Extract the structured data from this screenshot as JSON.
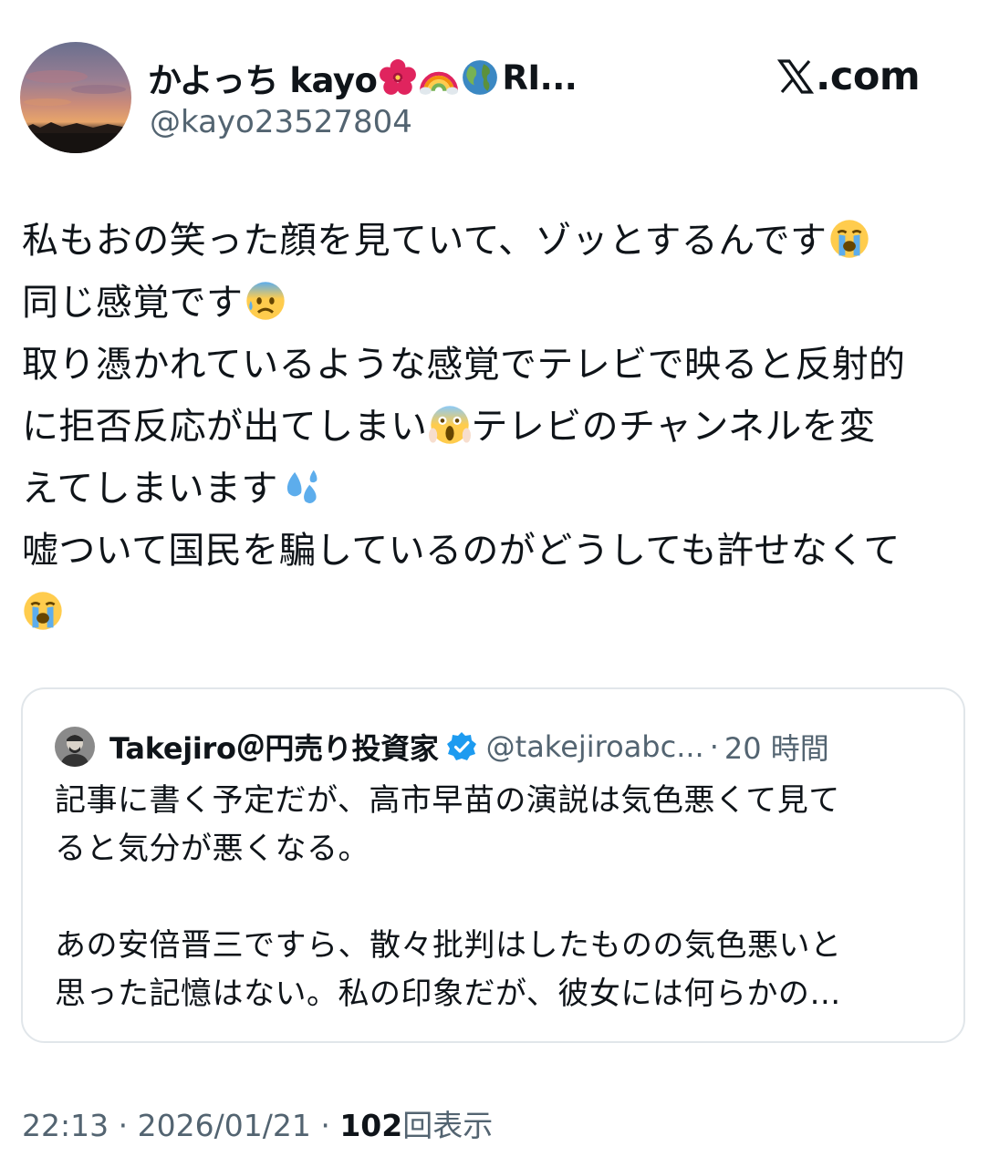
{
  "author": {
    "display_name": "かよっち kayo",
    "name_badges": [
      "hibiscus-emoji",
      "rainbow-emoji",
      "globe-emoji"
    ],
    "name_suffix": "RI...",
    "handle": "@kayo23527804"
  },
  "site": {
    "logo_text": ".com",
    "icon": "x-logo-icon"
  },
  "tweet": {
    "lines": [
      {
        "text": "私もおの笑った顔を見ていて、ゾッとするんです",
        "emoji": "loudly-crying-face"
      },
      {
        "text": "同じ感覚です",
        "emoji": "anxious-face-with-sweat"
      },
      {
        "text": "取り憑かれているような感覚でテレビで映ると反射的",
        "emoji": ""
      },
      {
        "text": "に拒否反応が出てしまい",
        "emoji": "face-screaming-in-fear",
        "text_after": "テレビのチャンネルを変"
      },
      {
        "text": "えてしまいます",
        "emoji": "sweat-droplets"
      },
      {
        "text": "嘘ついて国民を騙しているのがどうしても許せなくて",
        "emoji": ""
      },
      {
        "text": "",
        "emoji": "loudly-crying-face"
      }
    ]
  },
  "quote": {
    "author_name": "Takejiro＠円売り投資家",
    "verified_icon": "verified-badge-icon",
    "handle": "@takejiroabc...",
    "separator": "·",
    "time": "20 時間",
    "lines": [
      "記事に書く予定だが、高市早苗の演説は気色悪くて見て",
      "ると気分が悪くなる。",
      "",
      "あの安倍晋三ですら、散々批判はしたものの気色悪いと",
      "思った記憶はない。私の印象だが、彼女には何らかの…"
    ]
  },
  "meta": {
    "time": "22:13",
    "separator": "·",
    "date": "2026/01/21",
    "views_count": "102",
    "views_label": "回表示"
  },
  "colors": {
    "text": "#0f1419",
    "secondary": "#536471",
    "border": "#e1e6ea",
    "verified": "#1d9bf0"
  }
}
